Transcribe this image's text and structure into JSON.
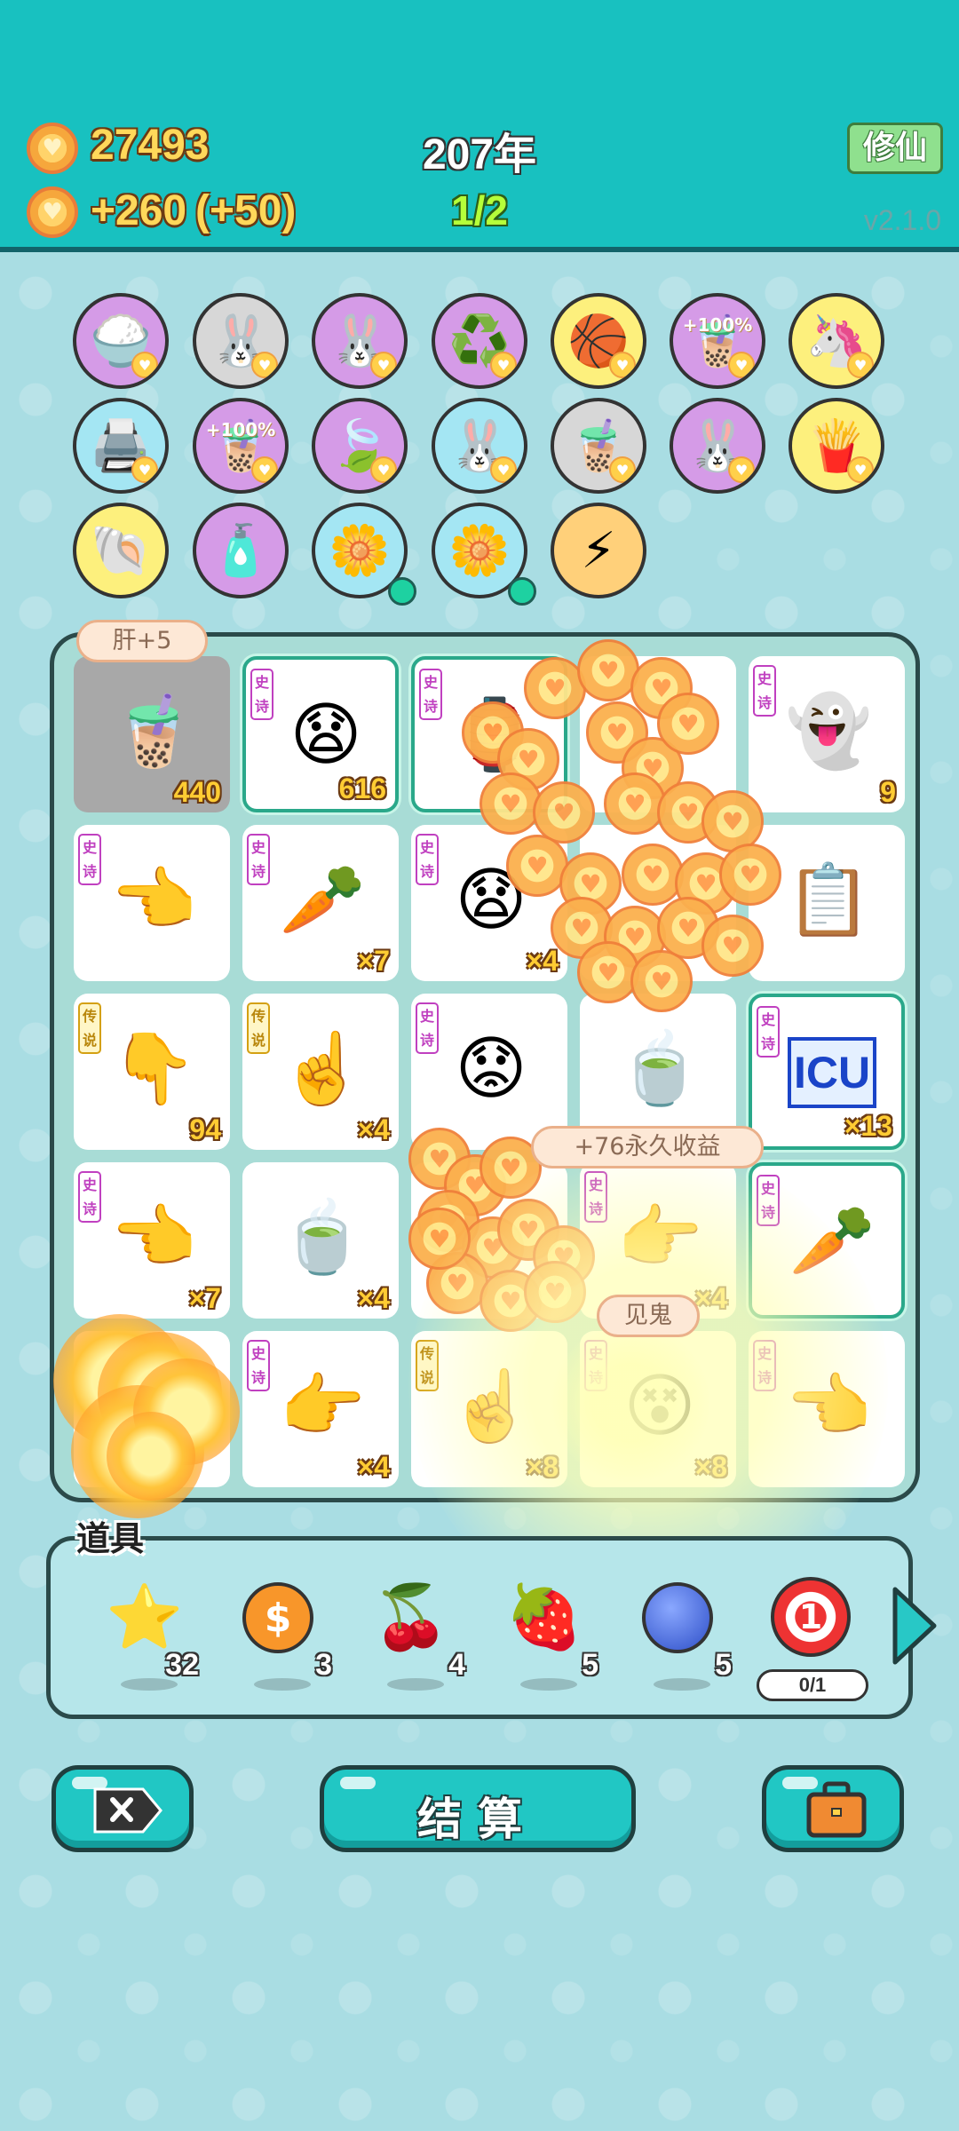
{
  "header": {
    "coins": "27493",
    "income": "+260",
    "income_bonus": "(+50)",
    "year": "207年",
    "progress": "1/2",
    "mode_button": "修仙",
    "version": "v2.1.0"
  },
  "relics": [
    {
      "icon": "rice-bowl-icon",
      "glyph": "🍚",
      "color": "purple"
    },
    {
      "icon": "rabbit-icon",
      "glyph": "🐰",
      "color": "gray"
    },
    {
      "icon": "rabbit-icon",
      "glyph": "🐰",
      "color": "purple"
    },
    {
      "icon": "recycle-icon",
      "glyph": "♻️",
      "color": "purple"
    },
    {
      "icon": "basketballs-icon",
      "glyph": "🏀",
      "color": "yellow"
    },
    {
      "icon": "milk-tea-icon",
      "glyph": "🧋",
      "color": "purple",
      "text": "+100%"
    },
    {
      "icon": "unicorn-icon",
      "glyph": "🦄",
      "color": "yellow"
    },
    {
      "icon": "printer-icon",
      "glyph": "🖨️",
      "color": "cyan"
    },
    {
      "icon": "milk-tea-icon",
      "glyph": "🧋",
      "color": "purple",
      "text": "+100%"
    },
    {
      "icon": "leaf-icon",
      "glyph": "🍃",
      "color": "purple"
    },
    {
      "icon": "rabbit-icon",
      "glyph": "🐰",
      "color": "cyan"
    },
    {
      "icon": "bubble-tea-icon",
      "glyph": "🧋",
      "color": "gray"
    },
    {
      "icon": "rabbit-icon",
      "glyph": "🐰",
      "color": "purple"
    },
    {
      "icon": "fries-icon",
      "glyph": "🍟",
      "color": "yellow"
    },
    {
      "icon": "shell-icon",
      "glyph": "🐚",
      "color": "yellow"
    },
    {
      "icon": "spray-bottle-icon",
      "glyph": "🧴",
      "color": "purple"
    },
    {
      "icon": "flower-pot-icon",
      "glyph": "🌼",
      "color": "cyan"
    },
    {
      "icon": "flower-pot-icon",
      "glyph": "🌼",
      "color": "cyan"
    },
    {
      "icon": "lightning-icon",
      "glyph": "⚡",
      "color": "gold"
    }
  ],
  "board": {
    "popup_top": "肝+5",
    "popup_income": "+76永久收益",
    "popup_ghost": "见鬼",
    "cells": [
      {
        "icon": "milk-tea-icon",
        "glyph": "🧋",
        "tag": "",
        "qty": "440",
        "style": "grayed"
      },
      {
        "icon": "face-icon",
        "glyph": "😧",
        "tag": "史诗",
        "qty": "616",
        "style": "highlight"
      },
      {
        "icon": "lantern-icon",
        "glyph": "🏮",
        "tag": "史诗",
        "qty": "",
        "style": "highlight"
      },
      {
        "icon": "coins-icon",
        "glyph": "",
        "tag": "",
        "qty": "",
        "style": ""
      },
      {
        "icon": "ghost-icon",
        "glyph": "👻",
        "tag": "史诗",
        "qty": "9",
        "style": ""
      },
      {
        "icon": "pointing-hand-icon",
        "glyph": "👈",
        "tag": "史诗",
        "qty": "",
        "style": ""
      },
      {
        "icon": "carrot-icon",
        "glyph": "🥕",
        "tag": "史诗",
        "qty": "×7",
        "style": ""
      },
      {
        "icon": "face-icon",
        "glyph": "😧",
        "tag": "史诗",
        "qty": "×4",
        "style": ""
      },
      {
        "icon": "coins-icon",
        "glyph": "",
        "tag": "",
        "qty": "",
        "style": ""
      },
      {
        "icon": "copy-paste-icon",
        "glyph": "📋",
        "tag": "",
        "qty": "",
        "style": ""
      },
      {
        "icon": "pointing-down-icon",
        "glyph": "👇",
        "tag": "传说",
        "qty": "94",
        "style": "legend"
      },
      {
        "icon": "pointing-up-icon",
        "glyph": "☝️",
        "tag": "传说",
        "qty": "×4",
        "style": "legend"
      },
      {
        "icon": "face-icon",
        "glyph": "😟",
        "tag": "史诗",
        "qty": "",
        "style": ""
      },
      {
        "icon": "tea-bowl-icon",
        "glyph": "🍵",
        "tag": "",
        "qty": "",
        "style": ""
      },
      {
        "icon": "icu-icon",
        "glyph": "ICU",
        "tag": "史诗",
        "qty": "×13",
        "style": "highlight"
      },
      {
        "icon": "pointing-hand-icon",
        "glyph": "👈",
        "tag": "史诗",
        "qty": "×7",
        "style": ""
      },
      {
        "icon": "tea-bowl-icon",
        "glyph": "🍵",
        "tag": "",
        "qty": "×4",
        "style": ""
      },
      {
        "icon": "coins-icon",
        "glyph": "",
        "tag": "",
        "qty": "",
        "style": ""
      },
      {
        "icon": "pointing-hand-icon",
        "glyph": "👉",
        "tag": "史诗",
        "qty": "×4",
        "style": ""
      },
      {
        "icon": "carrot-icon",
        "glyph": "🥕",
        "tag": "史诗",
        "qty": "",
        "style": "highlight"
      },
      {
        "icon": "pot-icon",
        "glyph": "🍲",
        "tag": "",
        "qty": "",
        "style": ""
      },
      {
        "icon": "pointing-hand-icon",
        "glyph": "👉",
        "tag": "史诗",
        "qty": "×4",
        "style": ""
      },
      {
        "icon": "pointing-up-icon",
        "glyph": "☝️",
        "tag": "传说",
        "qty": "×8",
        "style": "legend"
      },
      {
        "icon": "face-icon",
        "glyph": "😵",
        "tag": "史诗",
        "qty": "×8",
        "style": ""
      },
      {
        "icon": "pointing-hand-icon",
        "glyph": "👈",
        "tag": "史诗",
        "qty": "",
        "style": ""
      }
    ]
  },
  "items": {
    "title": "道具",
    "list": [
      {
        "icon": "star-icon",
        "glyph": "⭐",
        "count": "32"
      },
      {
        "icon": "dollar-coin-icon",
        "glyph": "$",
        "count": "3"
      },
      {
        "icon": "lychee-icon",
        "glyph": "🍒",
        "count": "4"
      },
      {
        "icon": "strawberry-icon",
        "glyph": "🍓",
        "count": "5"
      },
      {
        "icon": "blueberry-icon",
        "glyph": "🫐",
        "count": "5"
      },
      {
        "icon": "target-icon",
        "glyph": "1",
        "count": ""
      }
    ],
    "limit": "0/1"
  },
  "bottom": {
    "settle_label": "结算"
  }
}
